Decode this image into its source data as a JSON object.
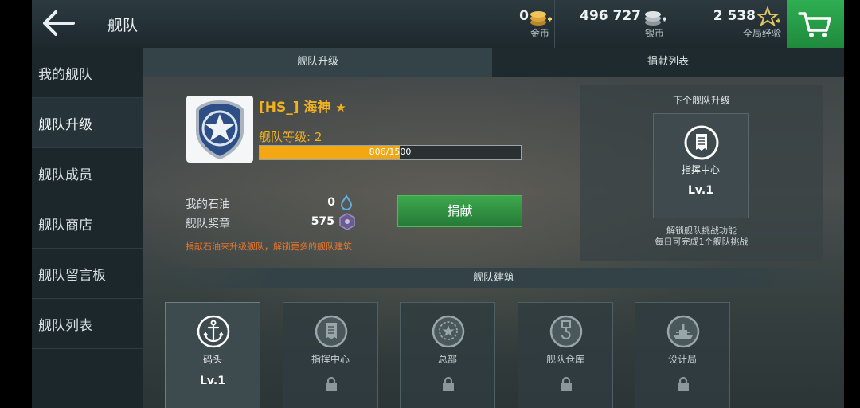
{
  "header": {
    "title": "舰队",
    "gold": {
      "value": "0",
      "label": "金币",
      "icon": "gold-coins-icon"
    },
    "silver": {
      "value": "496 727",
      "label": "银币",
      "icon": "silver-coins-icon"
    },
    "xp": {
      "value": "2 538",
      "label": "全局经验",
      "icon": "star-xp-icon"
    },
    "cart_icon": "shopping-cart-icon"
  },
  "sidebar": {
    "items": [
      {
        "label": "我的舰队",
        "active": false
      },
      {
        "label": "舰队升级",
        "active": true
      },
      {
        "label": "舰队成员",
        "active": false
      },
      {
        "label": "舰队商店",
        "active": false
      },
      {
        "label": "舰队留言板",
        "active": false
      },
      {
        "label": "舰队列表",
        "active": false
      }
    ]
  },
  "tabs": [
    {
      "label": "舰队升级",
      "active": true
    },
    {
      "label": "捐献列表",
      "active": false
    }
  ],
  "fleet": {
    "name": "[HS_] 海神",
    "star": "★",
    "level_text": "舰队等级: 2",
    "progress_text": "806/1500",
    "progress_current": 806,
    "progress_max": 1500
  },
  "stats": {
    "oil_label": "我的石油",
    "oil_value": "0",
    "medal_label": "舰队奖章",
    "medal_value": "575"
  },
  "donate_button": "捐献",
  "hint": "捐献石油来升级舰队，解锁更多的舰队建筑",
  "next_upgrade": {
    "title": "下个舰队升级",
    "building": "指挥中心",
    "level": "Lv.1",
    "desc_line1": "解锁舰队挑战功能",
    "desc_line2": "每日可完成1个舰队挑战"
  },
  "buildings": {
    "header": "舰队建筑",
    "items": [
      {
        "name": "码头",
        "level": "Lv.1",
        "locked": false,
        "icon": "anchor-icon"
      },
      {
        "name": "指挥中心",
        "level": "",
        "locked": true,
        "icon": "document-icon"
      },
      {
        "name": "总部",
        "level": "",
        "locked": true,
        "icon": "laurel-star-icon"
      },
      {
        "name": "舰队仓库",
        "level": "",
        "locked": true,
        "icon": "crane-hook-icon"
      },
      {
        "name": "设计局",
        "level": "",
        "locked": true,
        "icon": "warship-icon"
      }
    ]
  },
  "colors": {
    "accent": "#f2b21e",
    "button_green": "#2f9a44",
    "progress": "#f3a712",
    "hint": "#e8762a"
  }
}
